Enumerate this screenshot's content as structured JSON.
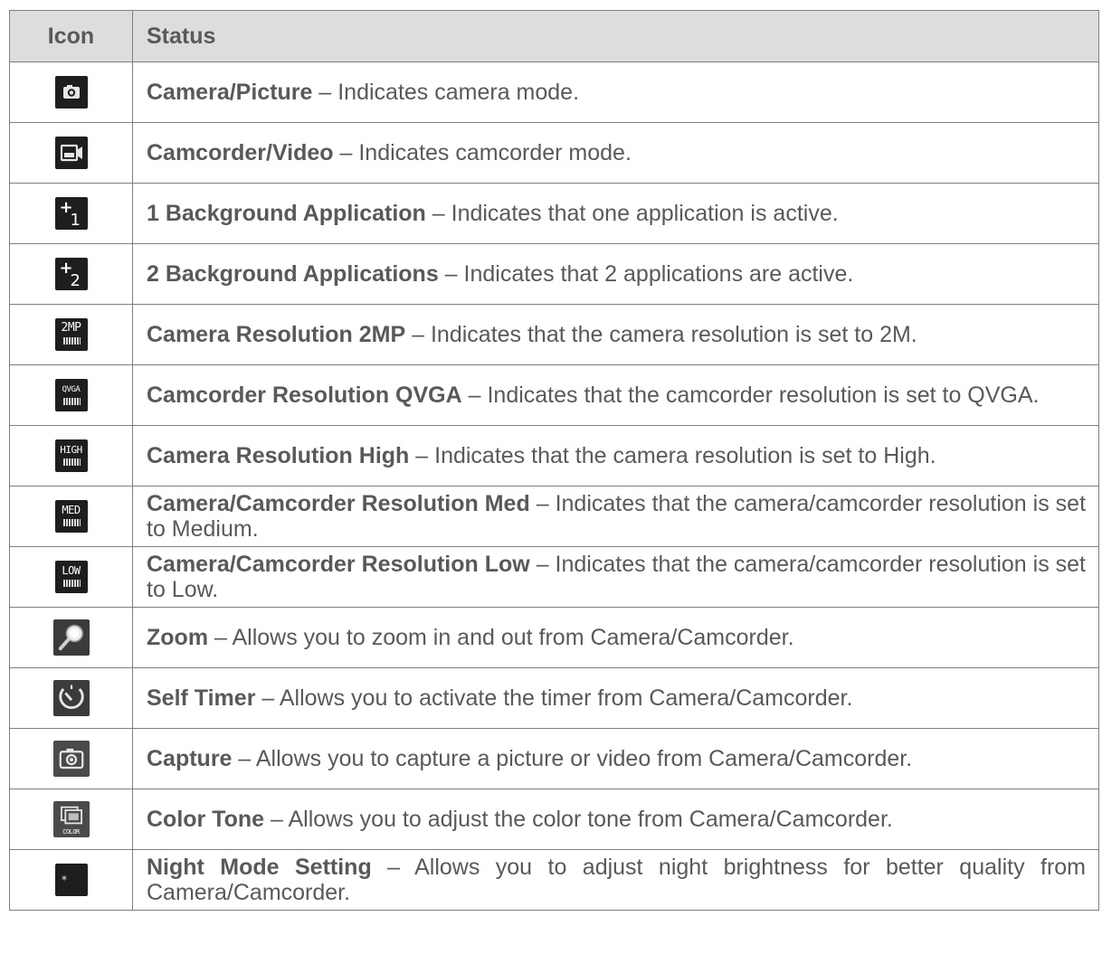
{
  "header": {
    "icon": "Icon",
    "status": "Status"
  },
  "rows": [
    {
      "icon": "camera-icon",
      "title": "Camera/Picture",
      "desc": " – Indicates camera mode."
    },
    {
      "icon": "camcorder-icon",
      "title": "Camcorder/Video",
      "desc": " – Indicates camcorder mode."
    },
    {
      "icon": "one-background-app-icon",
      "icon_text": "1",
      "title": "1 Background Application",
      "desc": " – Indicates that one application is active."
    },
    {
      "icon": "two-background-apps-icon",
      "icon_text": "2",
      "title": "2 Background Applications",
      "desc": " – Indicates that 2 applications are active."
    },
    {
      "icon": "resolution-2mp-icon",
      "icon_text": "2MP",
      "title": "Camera Resolution 2MP",
      "desc": " – Indicates that the camera resolution is set to 2M."
    },
    {
      "icon": "resolution-qvga-icon",
      "icon_text": "QVGA",
      "title": "Camcorder Resolution QVGA",
      "desc": " – Indicates that the camcorder resolution is set to QVGA."
    },
    {
      "icon": "resolution-high-icon",
      "icon_text": "HIGH",
      "title": "Camera Resolution High",
      "desc": " – Indicates that the camera resolution is set to High."
    },
    {
      "icon": "resolution-med-icon",
      "icon_text": "MED",
      "title": "Camera/Camcorder Resolution Med",
      "desc": " – Indicates that the camera/camcorder resolution is set to Medium."
    },
    {
      "icon": "resolution-low-icon",
      "icon_text": "LOW",
      "title": "Camera/Camcorder Resolution Low",
      "desc": " – Indicates that the camera/camcorder resolution is set to Low."
    },
    {
      "icon": "zoom-icon",
      "title": "Zoom",
      "desc": " – Allows you to zoom in and out from Camera/Camcorder."
    },
    {
      "icon": "self-timer-icon",
      "title": "Self Timer",
      "desc": " – Allows you to activate the timer from Camera/Camcorder."
    },
    {
      "icon": "capture-icon",
      "title": "Capture",
      "desc": " – Allows you to capture a picture or video from Camera/Camcorder."
    },
    {
      "icon": "color-tone-icon",
      "icon_text": "COLOR",
      "title": "Color Tone",
      "desc": " – Allows you to adjust the color tone from Camera/Camcorder."
    },
    {
      "icon": "night-mode-icon",
      "title": "Night Mode Setting",
      "desc": " – Allows you to adjust night brightness for better quality from Camera/Camcorder."
    }
  ]
}
